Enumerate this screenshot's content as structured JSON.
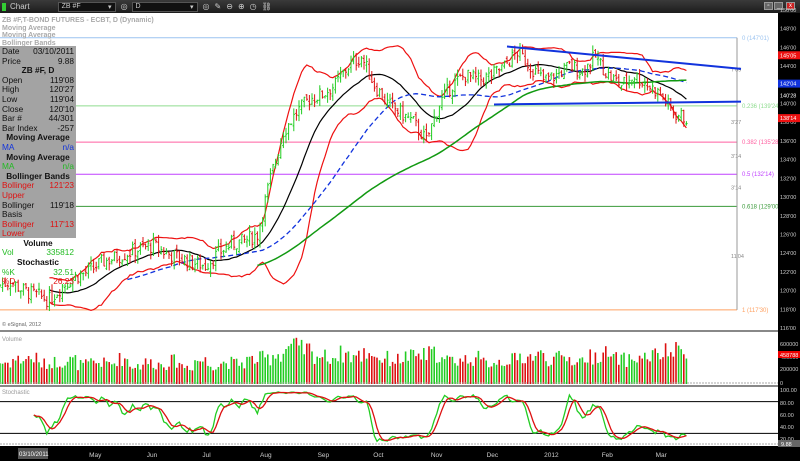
{
  "window": {
    "title": "Chart",
    "symbol": "ZB #F",
    "interval": "D"
  },
  "legend": [
    "ZB #F,T-BOND FUTURES - ECBT, D (Dynamic)",
    "Moving Average",
    "Moving Average",
    "Bollinger Bands"
  ],
  "info": {
    "date_label": "Date",
    "date": "03/10/2011",
    "price_label": "Price",
    "price": "9.88",
    "header": "ZB #F, D",
    "rows": [
      [
        "Open",
        "119'08"
      ],
      [
        "High",
        "120'27"
      ],
      [
        "Low",
        "119'04"
      ],
      [
        "Close",
        "120'10"
      ],
      [
        "Bar #",
        "44/301"
      ],
      [
        "Bar Index",
        "-257"
      ]
    ],
    "ma1_title": "Moving Average",
    "ma1": [
      "MA",
      "n/a"
    ],
    "ma2_title": "Moving Average",
    "ma2": [
      "MA",
      "n/a"
    ],
    "bb_title": "Bollinger Bands",
    "bb": [
      [
        "Bollinger Upper",
        "121'23"
      ],
      [
        "Bollinger Basis",
        "119'18"
      ],
      [
        "Bollinger Lower",
        "117'13"
      ]
    ],
    "vol_title": "Volume",
    "vol": [
      "Vol",
      "335812"
    ],
    "stoch_title": "Stochastic",
    "k": [
      "%K",
      "32.51"
    ],
    "d": [
      "%D",
      "26.23"
    ]
  },
  "copyright": "© eSignal, 2012",
  "panes": {
    "volume": "Volume",
    "stochastic": "Stochastic"
  },
  "cursor_date": "03/10/2011",
  "colors": {
    "up": "#22cc22",
    "down": "#dd1111",
    "bb": "#ee1111",
    "basis": "#000000",
    "ma_blue": "#1133dd",
    "ma_green": "#119911"
  },
  "chart_data": [
    {
      "type": "ohlc",
      "x_start": "2011-03-14",
      "x_interval": "1 week",
      "weekly_close": [
        120.5,
        121,
        120,
        119.5,
        119,
        120.5,
        121.5,
        122,
        123,
        123.5,
        124,
        124.5,
        124.8,
        124,
        123.5,
        123,
        122.7,
        124,
        125,
        125.3,
        126,
        132,
        137,
        139,
        140.5,
        141,
        142,
        144,
        145,
        142,
        140,
        139,
        138,
        136,
        140,
        142,
        143,
        142.5,
        143,
        144,
        145.5,
        144,
        142.5,
        143,
        144,
        143.5,
        145,
        143,
        142,
        143,
        142,
        141,
        139,
        138.4
      ],
      "y_ticks": [
        "150'00",
        "148'00",
        "146'00",
        "144'00",
        "142'00",
        "140'00",
        "138'00",
        "136'00",
        "134'00",
        "132'00",
        "130'00",
        "128'00",
        "126'00",
        "124'00",
        "122'00",
        "120'00",
        "118'00",
        "116'00"
      ],
      "ylim": [
        116,
        150
      ],
      "x_ticks": [
        {
          "label": "May",
          "date": "2011-05-01"
        },
        {
          "label": "Jun",
          "date": "2011-06-01"
        },
        {
          "label": "Jul",
          "date": "2011-07-01"
        },
        {
          "label": "Aug",
          "date": "2011-08-01"
        },
        {
          "label": "Sep",
          "date": "2011-09-01"
        },
        {
          "label": "Oct",
          "date": "2011-10-01"
        },
        {
          "label": "Nov",
          "date": "2011-11-01"
        },
        {
          "label": "Dec",
          "date": "2011-12-01"
        },
        {
          "label": "2012",
          "date": "2012-01-01"
        },
        {
          "label": "Feb",
          "date": "2012-02-01"
        },
        {
          "label": "Mar",
          "date": "2012-03-01"
        }
      ],
      "price_tags": [
        {
          "label": "145'05",
          "value": 145.16,
          "color": "#ee1111"
        },
        {
          "label": "142'04",
          "value": 142.13,
          "color": "#1133dd"
        },
        {
          "label": "140'28",
          "value": 140.88,
          "color": "#000000"
        },
        {
          "label": "138'14",
          "value": 138.44,
          "color": "#ee1111"
        }
      ],
      "fib_levels": [
        {
          "label": "0 (147'01)",
          "value": 147.03,
          "color": "#9cc4f0"
        },
        {
          "label": "0.236 (139'24)",
          "value": 139.75,
          "color": "#8fdc8f"
        },
        {
          "label": "0.382 (135'28)",
          "value": 135.88,
          "color": "#ff5fa0"
        },
        {
          "label": "0.5 (132'14)",
          "value": 132.44,
          "color": "#c040ff"
        },
        {
          "label": "0.618 (129'00)",
          "value": 129.0,
          "color": "#3a9a3a"
        },
        {
          "label": "1 (117'30)",
          "value": 117.94,
          "color": "#ffa060"
        }
      ],
      "fib_spans": [
        {
          "label": "7'09",
          "value": 143.4
        },
        {
          "label": "3'27",
          "value": 137.8
        },
        {
          "label": "3'14",
          "value": 134.2
        },
        {
          "label": "3'14",
          "value": 130.8
        },
        {
          "label": "11'04",
          "value": 123.5
        }
      ],
      "trendlines": [
        {
          "from": {
            "date": "2011-12-12",
            "price": 146.1
          },
          "to": {
            "date": "2012-04-16",
            "price": 143.7
          },
          "color": "#1133dd"
        },
        {
          "from": {
            "date": "2011-12-05",
            "price": 139.9
          },
          "to": {
            "date": "2012-04-16",
            "price": 140.2
          },
          "color": "#1133dd"
        }
      ]
    },
    {
      "type": "bar",
      "name": "Volume",
      "weekly_volume": [
        300000,
        340000,
        360000,
        280000,
        310000,
        330000,
        270000,
        300000,
        290000,
        350000,
        260000,
        300000,
        280000,
        320000,
        250000,
        330000,
        270000,
        300000,
        290000,
        340000,
        360000,
        420000,
        520000,
        480000,
        400000,
        380000,
        420000,
        390000,
        440000,
        360000,
        340000,
        380000,
        400000,
        420000,
        330000,
        340000,
        360000,
        300000,
        320000,
        340000,
        380000,
        400000,
        350000,
        360000,
        330000,
        380000,
        420000,
        350000,
        340000,
        370000,
        400000,
        440000,
        460000,
        458788
      ],
      "y_ticks": [
        "600000",
        "400000",
        "200000",
        "0"
      ],
      "last_tag": "458788",
      "ylim": [
        0,
        700000
      ]
    },
    {
      "type": "line",
      "name": "Stochastic",
      "y_ticks": [
        "100.00",
        "80.00",
        "60.00",
        "40.00",
        "20.00"
      ],
      "levels": [
        80,
        20
      ],
      "last_tag": "9.88",
      "ylim": [
        0,
        100
      ]
    }
  ]
}
